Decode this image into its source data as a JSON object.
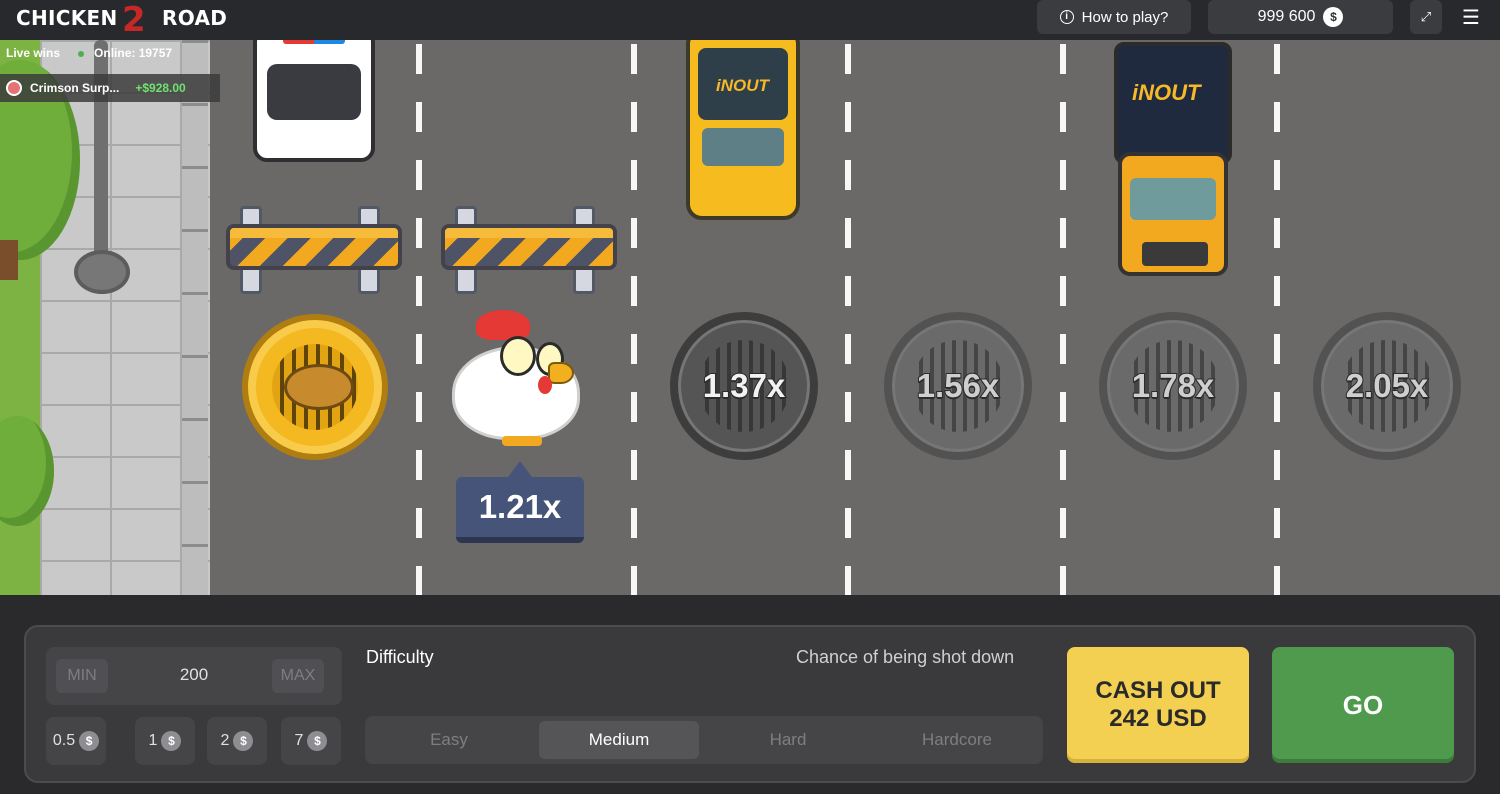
{
  "header": {
    "logo_part1": "CHICKEN",
    "logo_two": "2",
    "logo_part2": "ROAD",
    "howto_label": "How to play?",
    "balance": "999 600",
    "currency_symbol": "$"
  },
  "live_wins": {
    "title": "Live wins",
    "online_label": "Online: 19757",
    "entry": {
      "name": "Crimson Surp...",
      "amount": "+$928.00"
    }
  },
  "game": {
    "current_multiplier": "1.21x",
    "multipliers": [
      "1.37x",
      "1.56x",
      "1.78x",
      "2.05x"
    ],
    "vehicle_brand": "iNOUT"
  },
  "controls": {
    "min_label": "MIN",
    "max_label": "MAX",
    "bet_value": "200",
    "chips": [
      "0.5",
      "1",
      "2",
      "7"
    ],
    "difficulty_label": "Difficulty",
    "chance_label": "Chance of being shot down",
    "difficulty_options": [
      "Easy",
      "Medium",
      "Hard",
      "Hardcore"
    ],
    "difficulty_selected": "Medium",
    "cashout_line1": "CASH OUT",
    "cashout_line2": "242 USD",
    "go_label": "GO"
  },
  "colors": {
    "cashout": "#f4d052",
    "go": "#4f9a4d",
    "road": "#6b6868",
    "badge": "#475479",
    "win_amount": "#6ee36e"
  }
}
